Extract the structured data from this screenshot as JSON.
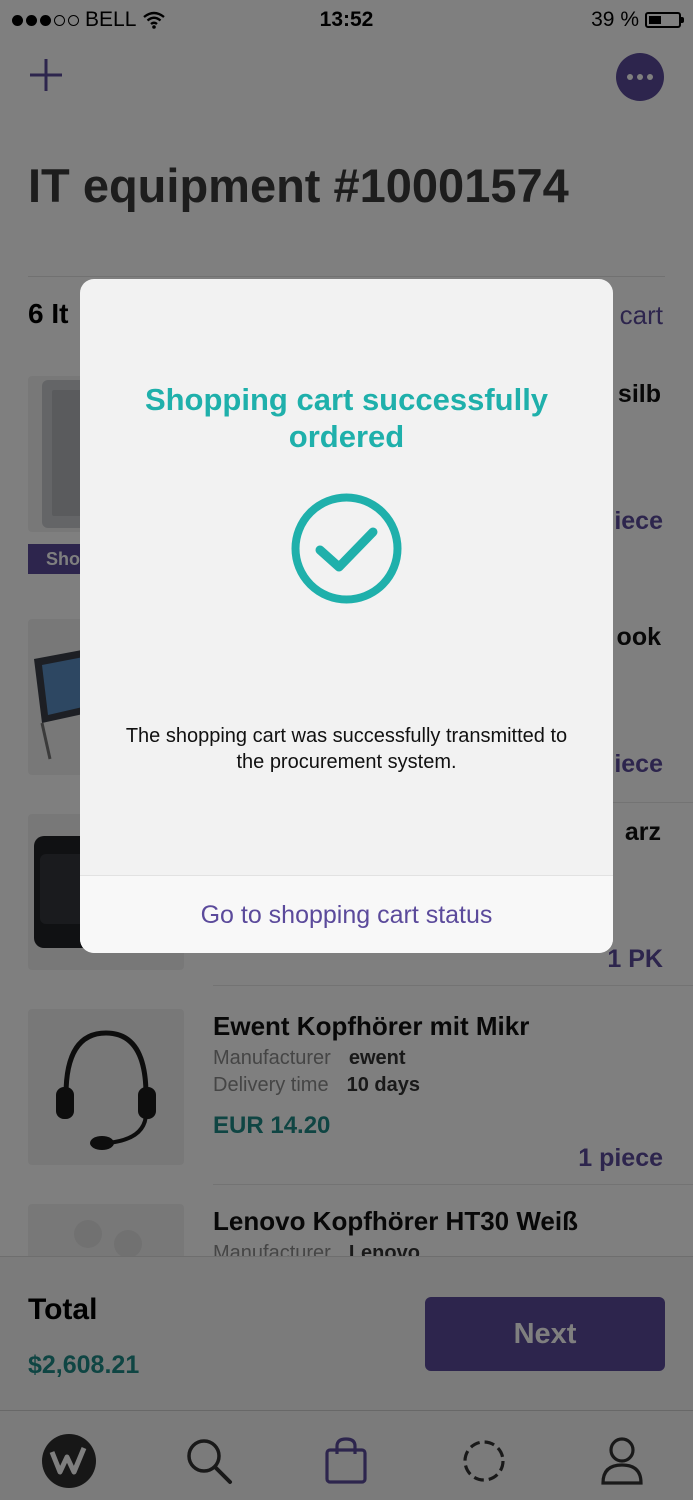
{
  "status_bar": {
    "carrier": "BELL",
    "time": "13:52",
    "battery": "39 %"
  },
  "header": {
    "title": "IT equipment #10001574"
  },
  "cart": {
    "count_label": "6 It",
    "link_label": "cart",
    "items": [
      {
        "name": "silb",
        "qty": "iece",
        "badge": "Sho"
      },
      {
        "name": "ook",
        "qty": "iece"
      },
      {
        "name": "arz",
        "qty": "1 PK"
      },
      {
        "name": "Ewent Kopfhörer mit Mikr",
        "manufacturer_label": "Manufacturer",
        "manufacturer": "ewent",
        "delivery_label": "Delivery time",
        "delivery": "10 days",
        "price": "EUR 14.20",
        "qty": "1 piece"
      },
      {
        "name": "Lenovo Kopfhörer HT30 Weiß",
        "manufacturer_label": "Manufacturer",
        "manufacturer": "Lenovo"
      }
    ]
  },
  "footer": {
    "total_label": "Total",
    "total_value": "$2,608.21",
    "next_label": "Next"
  },
  "tabbar": {
    "icons": [
      "logo-icon",
      "search-icon",
      "bag-icon",
      "spinner-icon",
      "user-icon"
    ]
  },
  "dialog": {
    "title": "Shopping cart successfully ordered",
    "message": "The shopping cart was successfully transmitted to the procurement system.",
    "action_label": "Go to shopping cart status"
  },
  "colors": {
    "accent": "#5b4a9b",
    "teal": "#1fb0ab",
    "price": "#1f8a86"
  }
}
